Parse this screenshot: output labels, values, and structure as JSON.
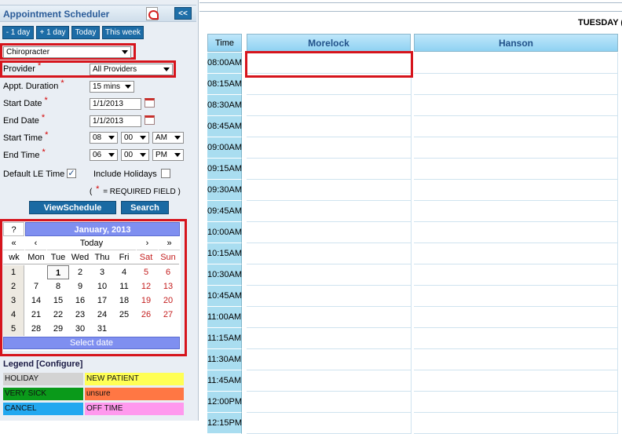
{
  "app": {
    "title": "Appointment Scheduler",
    "collapse_label": "<<"
  },
  "nav": {
    "minus_day": "- 1 day",
    "plus_day": "+ 1 day",
    "today": "Today",
    "this_week": "This week"
  },
  "form": {
    "specialty": "Chiropracter",
    "provider_label": "Provider",
    "provider_value": "All Providers",
    "duration_label": "Appt. Duration",
    "duration_value": "15 mins",
    "start_date_label": "Start Date",
    "start_date_value": "1/1/2013",
    "end_date_label": "End Date",
    "end_date_value": "1/1/2013",
    "start_time_label": "Start Time",
    "start_hour": "08",
    "start_min": "00",
    "start_ampm": "AM",
    "end_time_label": "End Time",
    "end_hour": "06",
    "end_min": "00",
    "end_ampm": "PM",
    "default_le_label": "Default LE Time",
    "include_holidays_label": "Include Holidays",
    "req_open": "(",
    "req_close": "= REQUIRED FIELD )",
    "asterisk": "*"
  },
  "actions": {
    "view_schedule": "ViewSchedule",
    "search": "Search"
  },
  "calendar": {
    "help": "?",
    "month": "January, 2013",
    "nav": {
      "prev_year": "«",
      "prev_month": "‹",
      "today": "Today",
      "next_month": "›",
      "next_year": "»"
    },
    "wk_label": "wk",
    "days": [
      "Mon",
      "Tue",
      "Wed",
      "Thu",
      "Fri",
      "Sat",
      "Sun"
    ],
    "weeks": [
      {
        "wk": "1",
        "dates": [
          "",
          "1",
          "2",
          "3",
          "4",
          "5",
          "6"
        ]
      },
      {
        "wk": "2",
        "dates": [
          "7",
          "8",
          "9",
          "10",
          "11",
          "12",
          "13"
        ]
      },
      {
        "wk": "3",
        "dates": [
          "14",
          "15",
          "16",
          "17",
          "18",
          "19",
          "20"
        ]
      },
      {
        "wk": "4",
        "dates": [
          "21",
          "22",
          "23",
          "24",
          "25",
          "26",
          "27"
        ]
      },
      {
        "wk": "5",
        "dates": [
          "28",
          "29",
          "30",
          "31",
          "",
          "",
          ""
        ]
      }
    ],
    "today_date": "1",
    "select_date": "Select date"
  },
  "legend": {
    "title": "Legend [Configure]",
    "items": [
      {
        "label": "HOLIDAY",
        "color": "#d3d3d3"
      },
      {
        "label": "NEW PATIENT",
        "color": "#ffff55"
      },
      {
        "label": "VERY SICK",
        "color": "#0a9a1a"
      },
      {
        "label": "unsure",
        "color": "#ff7744"
      },
      {
        "label": "CANCEL",
        "color": "#22a8f0"
      },
      {
        "label": "OFF TIME",
        "color": "#ff99ee"
      }
    ]
  },
  "schedule": {
    "day_label": "TUESDAY (",
    "time_header": "Time",
    "providers": [
      "Morelock",
      "Hanson"
    ],
    "times": [
      "08:00AM",
      "08:15AM",
      "08:30AM",
      "08:45AM",
      "09:00AM",
      "09:15AM",
      "09:30AM",
      "09:45AM",
      "10:00AM",
      "10:15AM",
      "10:30AM",
      "10:45AM",
      "11:00AM",
      "11:15AM",
      "11:30AM",
      "11:45AM",
      "12:00PM",
      "12:15PM"
    ]
  },
  "colors": {
    "accent": "#1d6ca6",
    "highlight": "#d6141c",
    "calendar_header": "#7f8ff0",
    "time_column": "#a9ddf0"
  }
}
